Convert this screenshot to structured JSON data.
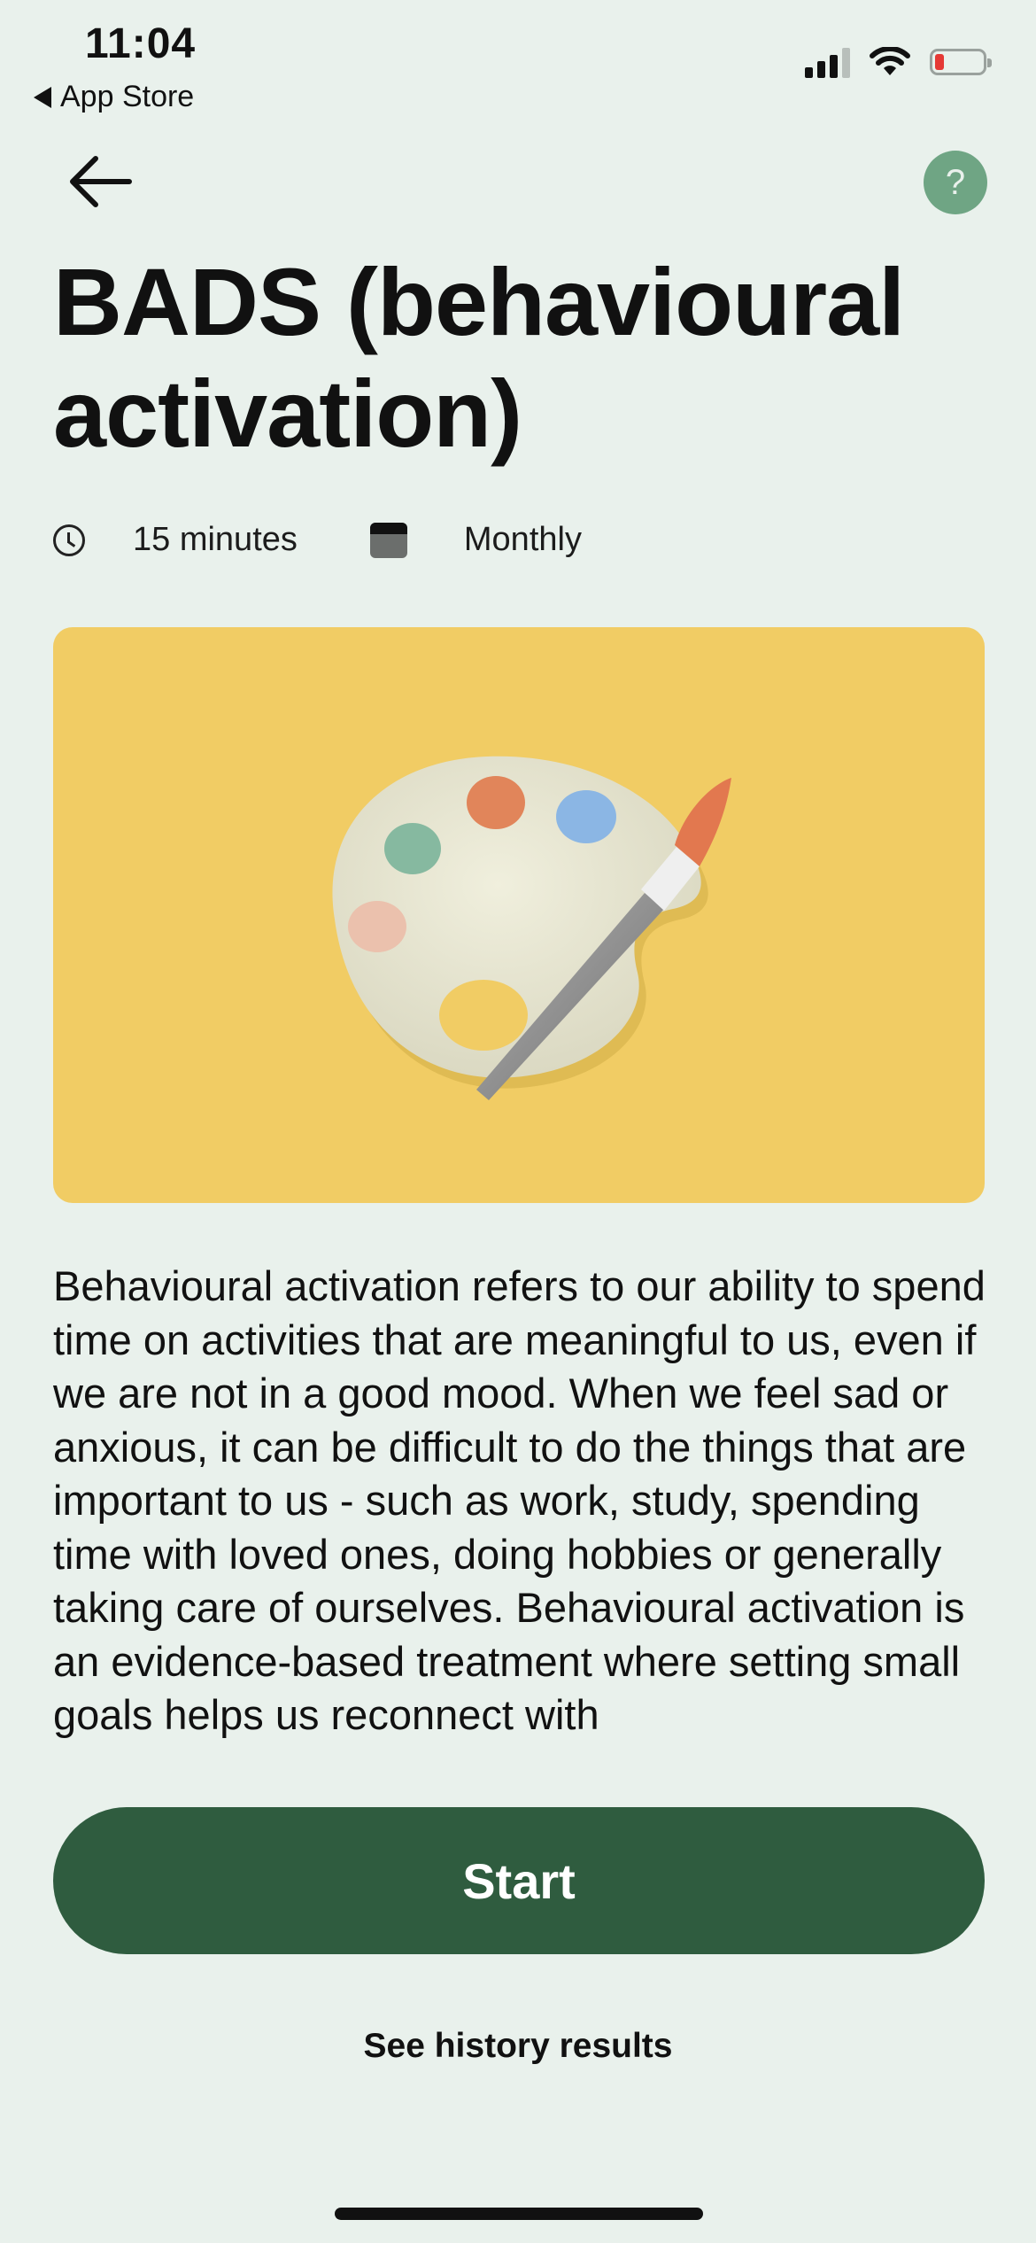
{
  "status_bar": {
    "time": "11:04",
    "back_app_label": "App Store",
    "battery_color": "#e53935"
  },
  "header": {
    "back_icon": "arrow-left-icon",
    "help_label": "?"
  },
  "title": "BADS (behavioural activation)",
  "meta": {
    "duration": "15 minutes",
    "frequency": "Monthly",
    "duration_icon": "clock-icon",
    "frequency_icon": "calendar-icon"
  },
  "hero": {
    "illustration": "paint-palette-icon",
    "background_color": "#f1cc64"
  },
  "description": "Behavioural activation refers to our ability to spend time on activities that are meaningful to us, even if we are not in a good mood. When we feel sad or anxious, it can be difficult to do the things that are important to us - such as work, study, spending time with loved ones, doing hobbies or generally taking care of ourselves. Behavioural activation is an evidence-based treatment where setting small goals helps us reconnect with",
  "actions": {
    "start_label": "Start",
    "history_label": "See history results"
  },
  "colors": {
    "background": "#e9f1ec",
    "primary_button": "#2f5c3f",
    "help_button": "#6fa584"
  }
}
